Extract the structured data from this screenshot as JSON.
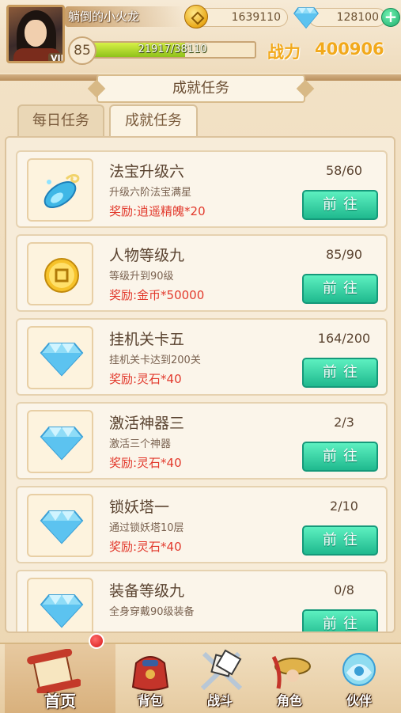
{
  "player": {
    "name": "躺倒的小火龙",
    "vip": "VIP5",
    "level": "85",
    "exp_text": "21917/38110",
    "exp_fraction": 0.575,
    "power_label": "战力",
    "power_value": "400906"
  },
  "resources": {
    "gold": "1639110",
    "gems": "128100",
    "gold_icon": "coin-icon",
    "gem_icon": "diamond-icon",
    "add_icon": "plus-icon"
  },
  "title": "成就任务",
  "tabs": [
    {
      "label": "每日任务",
      "active": false
    },
    {
      "label": "成就任务",
      "active": true
    }
  ],
  "tasks": [
    {
      "name": "法宝升级六",
      "desc": "升级六阶法宝满星",
      "reward": "奖励:逍遥精魄*20",
      "progress": "58/60",
      "button": "前往",
      "icon": "magic-treasure-icon"
    },
    {
      "name": "人物等级九",
      "desc": "等级升到90级",
      "reward": "奖励:金币*50000",
      "progress": "85/90",
      "button": "前往",
      "icon": "gold-coin-icon"
    },
    {
      "name": "挂机关卡五",
      "desc": "挂机关卡达到200关",
      "reward": "奖励:灵石*40",
      "progress": "164/200",
      "button": "前往",
      "icon": "diamond-icon"
    },
    {
      "name": "激活神器三",
      "desc": "激活三个神器",
      "reward": "奖励:灵石*40",
      "progress": "2/3",
      "button": "前往",
      "icon": "diamond-icon"
    },
    {
      "name": "锁妖塔一",
      "desc": "通过锁妖塔10层",
      "reward": "奖励:灵石*40",
      "progress": "2/10",
      "button": "前往",
      "icon": "diamond-icon"
    },
    {
      "name": "装备等级九",
      "desc": "全身穿戴90级装备",
      "reward": "",
      "progress": "0/8",
      "button": "前往",
      "icon": "diamond-icon"
    }
  ],
  "nav": [
    {
      "label": "首页",
      "icon": "scroll-icon",
      "active": true
    },
    {
      "label": "背包",
      "icon": "bag-icon",
      "active": false
    },
    {
      "label": "战斗",
      "icon": "swords-icon",
      "active": false
    },
    {
      "label": "角色",
      "icon": "character-icon",
      "active": false
    },
    {
      "label": "伙伴",
      "icon": "partner-icon",
      "active": false
    }
  ],
  "colors": {
    "accent_green": "#1fb98e",
    "reward_red": "#e2392c",
    "power_gold": "#f2a91b",
    "notification_red": "#d71818"
  }
}
